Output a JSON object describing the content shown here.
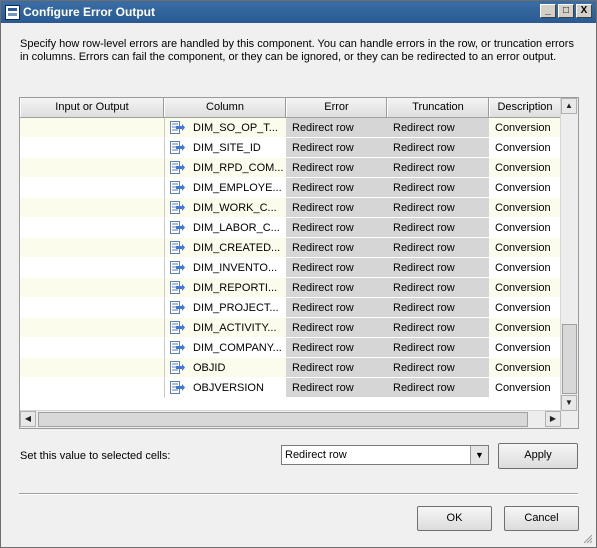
{
  "window": {
    "title": "Configure Error Output",
    "controls": [
      "_",
      "□",
      "X"
    ]
  },
  "description": "Specify how row-level errors are handled by this component. You can handle errors in the row, or truncation errors in columns. Errors can fail the component, or they can be ignored, or they can be redirected to an error output.",
  "grid": {
    "headers": [
      "Input or Output",
      "Column",
      "Error",
      "Truncation",
      "Description"
    ],
    "rows": [
      {
        "column": "DIM_SO_OP_T...",
        "error": "Redirect row",
        "truncation": "Redirect row",
        "description": "Conversion"
      },
      {
        "column": "DIM_SITE_ID",
        "error": "Redirect row",
        "truncation": "Redirect row",
        "description": "Conversion"
      },
      {
        "column": "DIM_RPD_COM...",
        "error": "Redirect row",
        "truncation": "Redirect row",
        "description": "Conversion"
      },
      {
        "column": "DIM_EMPLOYE...",
        "error": "Redirect row",
        "truncation": "Redirect row",
        "description": "Conversion"
      },
      {
        "column": "DIM_WORK_C...",
        "error": "Redirect row",
        "truncation": "Redirect row",
        "description": "Conversion"
      },
      {
        "column": "DIM_LABOR_C...",
        "error": "Redirect row",
        "truncation": "Redirect row",
        "description": "Conversion"
      },
      {
        "column": "DIM_CREATED...",
        "error": "Redirect row",
        "truncation": "Redirect row",
        "description": "Conversion"
      },
      {
        "column": "DIM_INVENTO...",
        "error": "Redirect row",
        "truncation": "Redirect row",
        "description": "Conversion"
      },
      {
        "column": "DIM_REPORTI...",
        "error": "Redirect row",
        "truncation": "Redirect row",
        "description": "Conversion"
      },
      {
        "column": "DIM_PROJECT...",
        "error": "Redirect row",
        "truncation": "Redirect row",
        "description": "Conversion"
      },
      {
        "column": "DIM_ACTIVITY...",
        "error": "Redirect row",
        "truncation": "Redirect row",
        "description": "Conversion"
      },
      {
        "column": "DIM_COMPANY...",
        "error": "Redirect row",
        "truncation": "Redirect row",
        "description": "Conversion"
      },
      {
        "column": "OBJID",
        "error": "Redirect row",
        "truncation": "Redirect row",
        "description": "Conversion"
      },
      {
        "column": "OBJVERSION",
        "error": "Redirect row",
        "truncation": "Redirect row",
        "description": "Conversion"
      }
    ]
  },
  "set_value": {
    "label": "Set this value to selected cells:",
    "selected": "Redirect row",
    "apply_label": "Apply"
  },
  "footer": {
    "ok_label": "OK",
    "cancel_label": "Cancel"
  },
  "colors": {
    "titlebar": "#3a6ea5",
    "error_column_bg": "#d6d6d6",
    "alt_row_bg": "#fcfcec"
  },
  "icons": {
    "column_icon": "column-arrow-icon"
  }
}
